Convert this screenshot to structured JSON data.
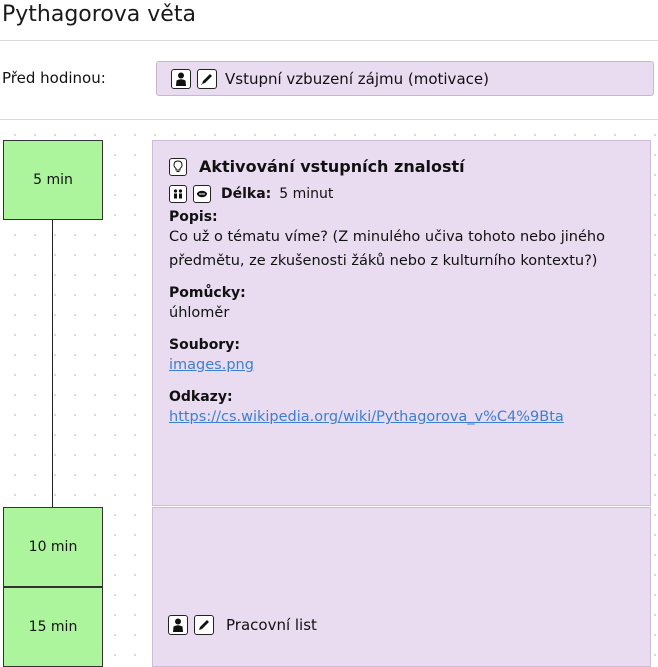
{
  "page": {
    "title": "Pythagorova věta"
  },
  "pre_lesson": {
    "label": "Před hodinou:",
    "icons": [
      "person-icon",
      "pencil-icon"
    ],
    "text": "Vstupní vzbuzení zájmu (motivace)"
  },
  "timeline": {
    "times": [
      "5 min",
      "10 min",
      "15 min"
    ]
  },
  "activity": {
    "icon": "lightbulb-icon",
    "title": "Aktivování vstupních znalostí",
    "meta_icons": [
      "group-icon",
      "speech-icon"
    ],
    "length_label": "Délka:",
    "length_value": "5 minut",
    "description_label": "Popis:",
    "description": "Co už o tématu víme? (Z minulého učiva tohoto nebo jiného předmětu, ze zkušenosti žáků nebo z kulturního kontextu?)",
    "tools_label": "Pomůcky:",
    "tools": "úhloměr",
    "files_label": "Soubory:",
    "file": "images.png",
    "links_label": "Odkazy:",
    "link": "https://cs.wikipedia.org/wiki/Pythagorova_v%C4%9Bta"
  },
  "activity2": {
    "icons": [
      "person-icon",
      "pencil-icon"
    ],
    "text": "Pracovní list"
  },
  "colors": {
    "card_bg": "#e9dcf0",
    "time_bg": "#adf59d",
    "link": "#3d7fcf"
  }
}
